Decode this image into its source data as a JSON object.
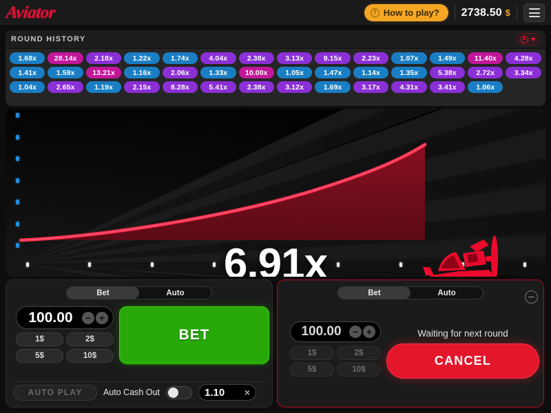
{
  "topbar": {
    "logo": "Aviator",
    "how_to_play": "How to play?",
    "how_to_play_icon": "question-circle-icon",
    "balance_amount": "2738.50",
    "balance_currency": "$",
    "menu_icon": "hamburger-menu-icon"
  },
  "history": {
    "title": "ROUND HISTORY",
    "toggle_icon": "clock-icon",
    "chevron_icon": "chevron-down-icon",
    "rows": [
      [
        {
          "v": "1.68x",
          "c": "b"
        },
        {
          "v": "28.14x",
          "c": "m"
        },
        {
          "v": "2.18x",
          "c": "p"
        },
        {
          "v": "1.22x",
          "c": "b"
        },
        {
          "v": "1.74x",
          "c": "b"
        },
        {
          "v": "4.04x",
          "c": "p"
        },
        {
          "v": "2.38x",
          "c": "p"
        },
        {
          "v": "3.13x",
          "c": "p"
        },
        {
          "v": "9.15x",
          "c": "p"
        },
        {
          "v": "2.23x",
          "c": "p"
        },
        {
          "v": "1.07x",
          "c": "b"
        },
        {
          "v": "1.49x",
          "c": "b"
        },
        {
          "v": "11.40x",
          "c": "m"
        },
        {
          "v": "4.28x",
          "c": "p"
        }
      ],
      [
        {
          "v": "1.41x",
          "c": "b"
        },
        {
          "v": "1.59x",
          "c": "b"
        },
        {
          "v": "13.21x",
          "c": "m"
        },
        {
          "v": "1.16x",
          "c": "b"
        },
        {
          "v": "2.06x",
          "c": "p"
        },
        {
          "v": "1.33x",
          "c": "b"
        },
        {
          "v": "10.00x",
          "c": "m"
        },
        {
          "v": "1.05x",
          "c": "b"
        },
        {
          "v": "1.47x",
          "c": "b"
        },
        {
          "v": "1.14x",
          "c": "b"
        },
        {
          "v": "1.35x",
          "c": "b"
        },
        {
          "v": "5.38x",
          "c": "p"
        },
        {
          "v": "2.72x",
          "c": "p"
        },
        {
          "v": "3.34x",
          "c": "p"
        }
      ],
      [
        {
          "v": "1.04x",
          "c": "b"
        },
        {
          "v": "2.65x",
          "c": "p"
        },
        {
          "v": "1.19x",
          "c": "b"
        },
        {
          "v": "2.15x",
          "c": "p"
        },
        {
          "v": "8.28x",
          "c": "p"
        },
        {
          "v": "5.41x",
          "c": "p"
        },
        {
          "v": "2.38x",
          "c": "p"
        },
        {
          "v": "3.12x",
          "c": "p"
        },
        {
          "v": "1.69x",
          "c": "b"
        },
        {
          "v": "3.17x",
          "c": "p"
        },
        {
          "v": "4.31x",
          "c": "p"
        },
        {
          "v": "3.41x",
          "c": "p"
        },
        {
          "v": "1.06x",
          "c": "b"
        },
        {
          "v": "",
          "c": "empty"
        }
      ]
    ],
    "colors": {
      "blue": "#1a7ec4",
      "purple": "#8b2fd6",
      "magenta": "#c2179b"
    }
  },
  "game": {
    "multiplier": "6.91x",
    "plane_icon": "airplane-icon",
    "curve_color": "#ff2b4d",
    "fill_color": "#7a0d1c"
  },
  "bet_left": {
    "tab_bet": "Bet",
    "tab_auto": "Auto",
    "stake": "100.00",
    "decrease_icon": "minus-circle-icon",
    "increase_icon": "plus-circle-icon",
    "quick_bets": [
      "1$",
      "2$",
      "5$",
      "10$"
    ],
    "action_label": "BET",
    "action_color": "#28a909",
    "auto_play": "AUTO PLAY",
    "auto_cash_out_label": "Auto Cash Out",
    "auto_cash_out_value": "1.10",
    "clear_icon": "close-x-icon",
    "toggle_icon": "toggle-switch-icon"
  },
  "bet_right": {
    "tab_bet": "Bet",
    "tab_auto": "Auto",
    "stake": "100.00",
    "decrease_icon": "minus-circle-icon",
    "increase_icon": "plus-circle-icon",
    "quick_bets": [
      "1$",
      "2$",
      "5$",
      "10$"
    ],
    "status": "Waiting for next round",
    "action_label": "CANCEL",
    "action_color": "#e3162b",
    "remove_icon": "minus-circle-icon"
  }
}
